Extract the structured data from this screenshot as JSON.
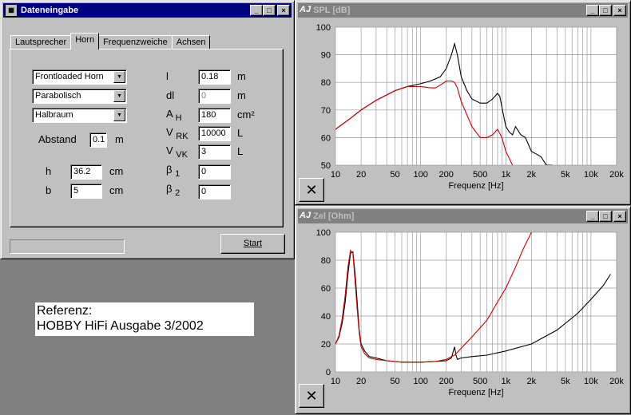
{
  "dialog": {
    "title": "Dateneingabe",
    "tabs": [
      "Lautsprecher",
      "Horn",
      "Frequenzweiche",
      "Achsen"
    ],
    "combo1": "Frontloaded Horn",
    "combo2": "Parabolisch",
    "combo3": "Halbraum",
    "abstand_label": "Abstand",
    "abstand_value": "0.1",
    "abstand_unit": "m",
    "h_label": "h",
    "h_value": "36.2",
    "h_unit": "cm",
    "b_label": "b",
    "b_value": "5",
    "b_unit": "cm",
    "l_label": "l",
    "l_value": "0.18",
    "l_unit": "m",
    "dl_label": "dl",
    "dl_value": "0",
    "dl_unit": "m",
    "ah_main": "A",
    "ah_sub": "H",
    "ah_value": "180",
    "ah_unit": "cm²",
    "vrk_main": "V",
    "vrk_sub": "RK",
    "vrk_value": "10000",
    "vrk_unit": "L",
    "vvk_main": "V",
    "vvk_sub": "VK",
    "vvk_value": "3",
    "vvk_unit": "L",
    "b1_main": "β",
    "b1_sub": "1",
    "b1_value": "0",
    "b2_main": "β",
    "b2_sub": "2",
    "b2_value": "0",
    "start": "Start",
    "win_btns": [
      "_",
      "□",
      "×"
    ]
  },
  "reference": {
    "line1": "Referenz:",
    "line2": "HOBBY HiFi Ausgabe 3/2002"
  },
  "spl_window": {
    "title": "SPL [dB]",
    "logo": "AJ",
    "close_btn": "✕"
  },
  "zel_window": {
    "title": "Zel [Ohm]",
    "logo": "AJ",
    "close_btn": "✕"
  },
  "chart_data": [
    {
      "type": "line",
      "title": "SPL [dB]",
      "xlabel": "Frequenz [Hz]",
      "ylabel": "",
      "x_scale": "log",
      "xlim": [
        10,
        20000
      ],
      "ylim": [
        50,
        100
      ],
      "yticks": [
        "100",
        "90",
        "80",
        "70",
        "60",
        "50"
      ],
      "xticks": [
        "10",
        "20",
        "50",
        "100",
        "200",
        "500",
        "1k",
        "2k",
        "5k",
        "10k",
        "20k"
      ],
      "grid": true,
      "series": [
        {
          "color": "#000000",
          "x": [
            10,
            15,
            20,
            30,
            50,
            70,
            100,
            130,
            170,
            200,
            230,
            250,
            270,
            300,
            350,
            400,
            500,
            600,
            700,
            800,
            850,
            900,
            1000,
            1100,
            1200,
            1300,
            1500,
            1700,
            2000,
            2300,
            2600,
            3000,
            3500
          ],
          "y": [
            63,
            67,
            70,
            73.5,
            77,
            78.5,
            79.5,
            80.5,
            82,
            85,
            90,
            94,
            90,
            82,
            77,
            74,
            72.5,
            72.5,
            74,
            76,
            75,
            71,
            64,
            62,
            61,
            64,
            61,
            60,
            55,
            54,
            53,
            50,
            50
          ]
        },
        {
          "color": "#cc0000",
          "x": [
            10,
            15,
            20,
            30,
            50,
            70,
            100,
            130,
            150,
            180,
            200,
            230,
            250,
            270,
            300,
            400,
            500,
            600,
            700,
            800,
            900,
            1000,
            1200
          ],
          "y": [
            63,
            67,
            70,
            73.5,
            77,
            78.5,
            78.5,
            78,
            78,
            79.5,
            80.5,
            80.5,
            80,
            78,
            73,
            64,
            60,
            60,
            61,
            63,
            60,
            55,
            50
          ]
        }
      ]
    },
    {
      "type": "line",
      "title": "Zel [Ohm]",
      "xlabel": "Frequenz [Hz]",
      "ylabel": "",
      "x_scale": "log",
      "xlim": [
        10,
        20000
      ],
      "ylim": [
        0,
        100
      ],
      "yticks": [
        "100",
        "80",
        "60",
        "40",
        "20",
        "0"
      ],
      "xticks": [
        "10",
        "20",
        "50",
        "100",
        "200",
        "500",
        "1k",
        "2k",
        "5k",
        "10k",
        "20k"
      ],
      "grid": true,
      "series": [
        {
          "color": "#000000",
          "x": [
            10,
            11,
            12,
            13,
            14,
            15,
            16,
            17,
            18,
            19,
            20,
            22,
            25,
            30,
            40,
            60,
            80,
            100,
            150,
            200,
            230,
            250,
            260,
            270,
            300,
            400,
            600,
            1000,
            2000,
            4000,
            7000,
            10000,
            14000,
            17000
          ],
          "y": [
            20,
            25,
            35,
            50,
            70,
            85,
            86,
            70,
            50,
            30,
            20,
            15,
            11,
            10,
            8,
            7,
            7,
            7,
            7.5,
            8,
            10,
            18,
            12,
            9,
            10,
            11,
            12,
            15,
            20,
            30,
            42,
            52,
            62,
            70
          ]
        },
        {
          "color": "#cc0000",
          "x": [
            10,
            11,
            12,
            13,
            14,
            15,
            16,
            17,
            18,
            19,
            20,
            22,
            25,
            30,
            40,
            60,
            80,
            100,
            150,
            200,
            230,
            250,
            300,
            400,
            600,
            800,
            1000,
            1300,
            1600,
            2000
          ],
          "y": [
            20,
            26,
            38,
            55,
            75,
            87,
            85,
            65,
            45,
            28,
            18,
            13,
            10,
            9,
            8,
            7,
            7,
            7,
            7.5,
            9,
            11,
            12,
            17,
            25,
            37,
            50,
            60,
            75,
            88,
            100
          ]
        }
      ]
    }
  ]
}
